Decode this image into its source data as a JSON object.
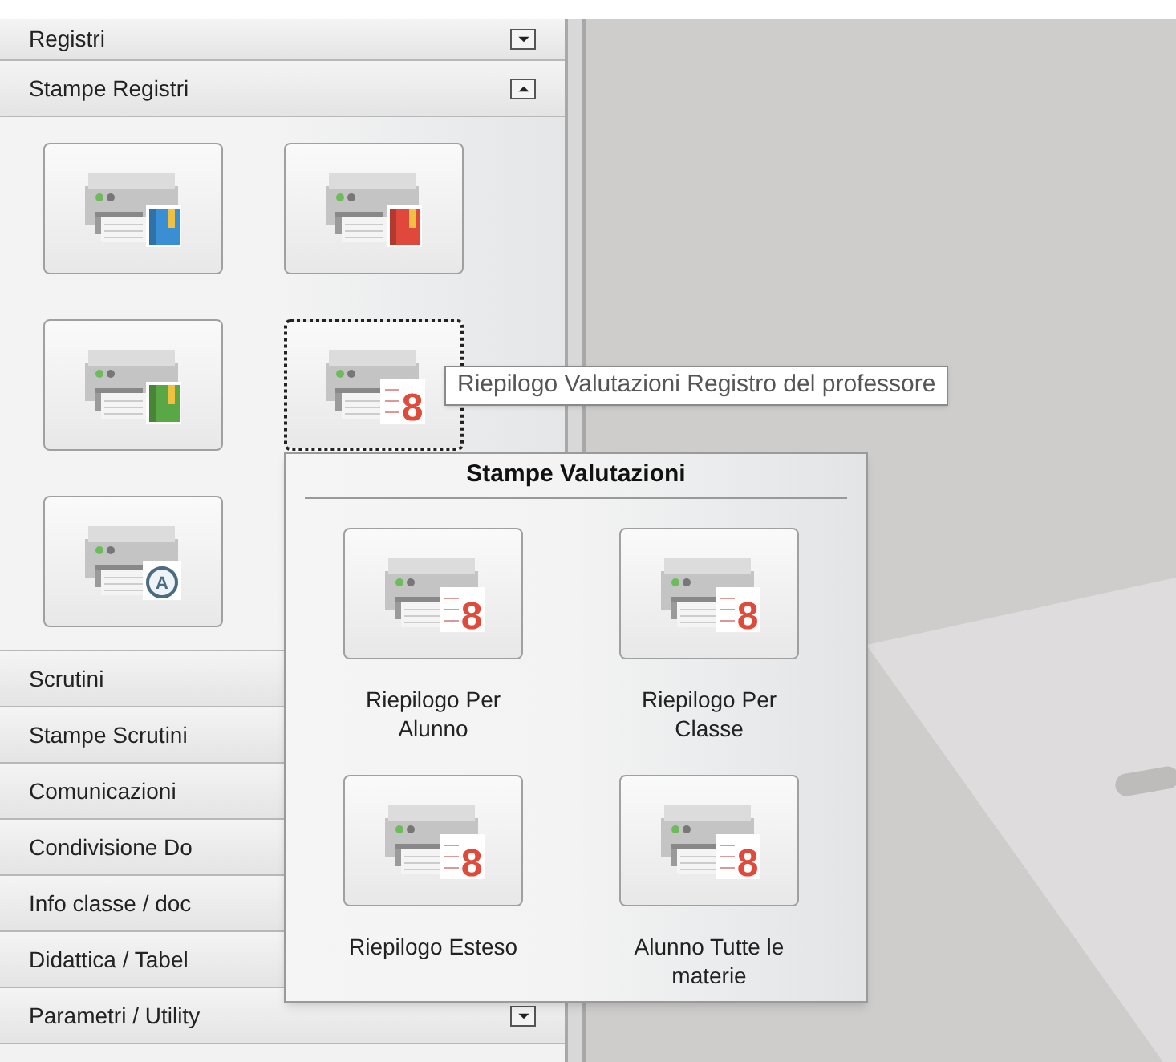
{
  "sidebar": {
    "sections": [
      {
        "title": "Registri",
        "expanded": false
      },
      {
        "title": "Stampe Registri",
        "expanded": true,
        "items": [
          {
            "kind": "book",
            "color": "#3a8fd4",
            "focused": false
          },
          {
            "kind": "book",
            "color": "#e0483b",
            "focused": false
          },
          {
            "kind": "book",
            "color": "#5aa845",
            "focused": false
          },
          {
            "kind": "grade",
            "badge": "8",
            "focused": true
          },
          {
            "kind": "circle",
            "badge": "A",
            "focused": false
          }
        ]
      },
      {
        "title": "Scrutini"
      },
      {
        "title": "Stampe Scrutini"
      },
      {
        "title": "Comunicazioni"
      },
      {
        "title": "Condivisione Do"
      },
      {
        "title": "Info classe / doc"
      },
      {
        "title": "Didattica / Tabel"
      },
      {
        "title": "Parametri / Utility",
        "expanded": false
      }
    ]
  },
  "tooltip": "Riepilogo Valutazioni Registro del professore",
  "popup": {
    "title": "Stampe Valutazioni",
    "items": [
      {
        "label": "Riepilogo Per Alunno",
        "badge": "8"
      },
      {
        "label": "Riepilogo Per Classe",
        "badge": "8"
      },
      {
        "label": "Riepilogo Esteso",
        "badge": "8"
      },
      {
        "label": "Alunno Tutte le materie",
        "badge": "8"
      }
    ]
  }
}
